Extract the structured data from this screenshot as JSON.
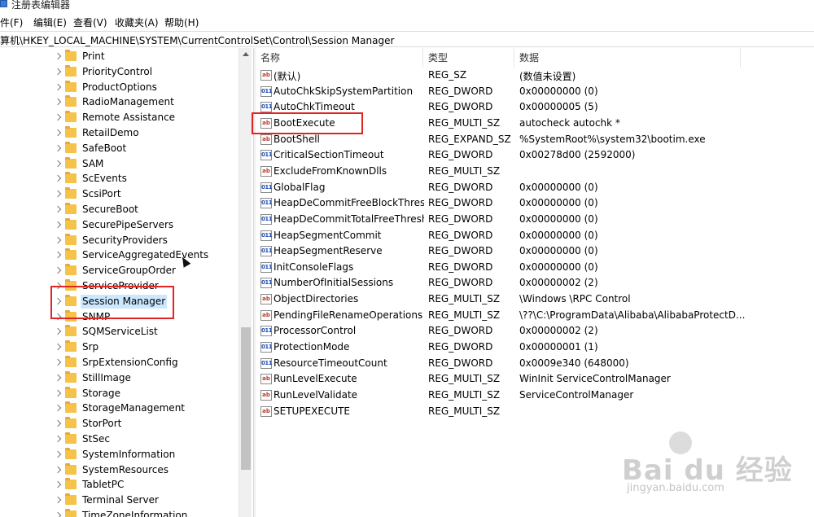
{
  "window": {
    "title": "注册表编辑器"
  },
  "menu": [
    "文件(F)",
    "编辑(E)",
    "查看(V)",
    "收藏夹(A)",
    "帮助(H)"
  ],
  "address": {
    "path": "计算机\\HKEY_LOCAL_MACHINE\\SYSTEM\\CurrentControlSet\\Control\\Session Manager"
  },
  "tree": {
    "items": [
      {
        "label": "Print"
      },
      {
        "label": "PriorityControl"
      },
      {
        "label": "ProductOptions"
      },
      {
        "label": "RadioManagement"
      },
      {
        "label": "Remote Assistance"
      },
      {
        "label": "RetailDemo"
      },
      {
        "label": "SafeBoot"
      },
      {
        "label": "SAM"
      },
      {
        "label": "ScEvents"
      },
      {
        "label": "ScsiPort"
      },
      {
        "label": "SecureBoot"
      },
      {
        "label": "SecurePipeServers"
      },
      {
        "label": "SecurityProviders"
      },
      {
        "label": "ServiceAggregatedEvents"
      },
      {
        "label": "ServiceGroupOrder"
      },
      {
        "label": "ServiceProvider"
      },
      {
        "label": "Session Manager",
        "selected": true
      },
      {
        "label": "SNMP"
      },
      {
        "label": "SQMServiceList"
      },
      {
        "label": "Srp"
      },
      {
        "label": "SrpExtensionConfig"
      },
      {
        "label": "StillImage"
      },
      {
        "label": "Storage"
      },
      {
        "label": "StorageManagement"
      },
      {
        "label": "StorPort"
      },
      {
        "label": "StSec"
      },
      {
        "label": "SystemInformation"
      },
      {
        "label": "SystemResources"
      },
      {
        "label": "TabletPC"
      },
      {
        "label": "Terminal Server"
      },
      {
        "label": "TimeZoneInformation"
      }
    ]
  },
  "list": {
    "columns": {
      "name": "名称",
      "type": "类型",
      "data": "数据"
    },
    "rows": [
      {
        "icon": "string-value-icon",
        "name": "(默认)",
        "type": "REG_SZ",
        "data": "(数值未设置)"
      },
      {
        "icon": "binary-value-icon",
        "name": "AutoChkSkipSystemPartition",
        "type": "REG_DWORD",
        "data": "0x00000000 (0)"
      },
      {
        "icon": "binary-value-icon",
        "name": "AutoChkTimeout",
        "type": "REG_DWORD",
        "data": "0x00000005 (5)"
      },
      {
        "icon": "string-value-icon",
        "name": "BootExecute",
        "type": "REG_MULTI_SZ",
        "data": "autocheck autochk *"
      },
      {
        "icon": "string-value-icon",
        "name": "BootShell",
        "type": "REG_EXPAND_SZ",
        "data": "%SystemRoot%\\system32\\bootim.exe"
      },
      {
        "icon": "binary-value-icon",
        "name": "CriticalSectionTimeout",
        "type": "REG_DWORD",
        "data": "0x00278d00 (2592000)"
      },
      {
        "icon": "string-value-icon",
        "name": "ExcludeFromKnownDlls",
        "type": "REG_MULTI_SZ",
        "data": ""
      },
      {
        "icon": "binary-value-icon",
        "name": "GlobalFlag",
        "type": "REG_DWORD",
        "data": "0x00000000 (0)"
      },
      {
        "icon": "binary-value-icon",
        "name": "HeapDeCommitFreeBlockThres...",
        "type": "REG_DWORD",
        "data": "0x00000000 (0)"
      },
      {
        "icon": "binary-value-icon",
        "name": "HeapDeCommitTotalFreeThresh",
        "type": "REG_DWORD",
        "data": "0x00000000 (0)"
      },
      {
        "icon": "binary-value-icon",
        "name": "HeapSegmentCommit",
        "type": "REG_DWORD",
        "data": "0x00000000 (0)"
      },
      {
        "icon": "binary-value-icon",
        "name": "HeapSegmentReserve",
        "type": "REG_DWORD",
        "data": "0x00000000 (0)"
      },
      {
        "icon": "binary-value-icon",
        "name": "InitConsoleFlags",
        "type": "REG_DWORD",
        "data": "0x00000000 (0)"
      },
      {
        "icon": "binary-value-icon",
        "name": "NumberOfInitialSessions",
        "type": "REG_DWORD",
        "data": "0x00000002 (2)"
      },
      {
        "icon": "string-value-icon",
        "name": "ObjectDirectories",
        "type": "REG_MULTI_SZ",
        "data": "\\Windows \\RPC Control"
      },
      {
        "icon": "string-value-icon",
        "name": "PendingFileRenameOperations",
        "type": "REG_MULTI_SZ",
        "data": "\\??\\C:\\ProgramData\\Alibaba\\AlibabaProtectD..."
      },
      {
        "icon": "binary-value-icon",
        "name": "ProcessorControl",
        "type": "REG_DWORD",
        "data": "0x00000002 (2)"
      },
      {
        "icon": "binary-value-icon",
        "name": "ProtectionMode",
        "type": "REG_DWORD",
        "data": "0x00000001 (1)"
      },
      {
        "icon": "binary-value-icon",
        "name": "ResourceTimeoutCount",
        "type": "REG_DWORD",
        "data": "0x0009e340 (648000)"
      },
      {
        "icon": "string-value-icon",
        "name": "RunLevelExecute",
        "type": "REG_MULTI_SZ",
        "data": "WinInit ServiceControlManager"
      },
      {
        "icon": "string-value-icon",
        "name": "RunLevelValidate",
        "type": "REG_MULTI_SZ",
        "data": "ServiceControlManager"
      },
      {
        "icon": "string-value-icon",
        "name": "SETUPEXECUTE",
        "type": "REG_MULTI_SZ",
        "data": ""
      }
    ]
  },
  "watermark": {
    "brand": "Bai du 经验",
    "site": "jingyan.baidu.com"
  },
  "colors": {
    "highlight_box": "#e22424",
    "selection": "#cce8ff",
    "folder": "#f5c24a"
  }
}
